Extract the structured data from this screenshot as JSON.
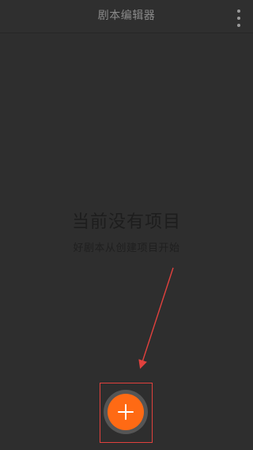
{
  "app_bar": {
    "title": "剧本编辑器",
    "menu_icon": "more-vertical-icon"
  },
  "empty_state": {
    "title": "当前没有项目",
    "subtitle": "好剧本从创建项目开始"
  },
  "fab": {
    "icon": "plus-icon",
    "color": "#ff6a14"
  },
  "annotation": {
    "color": "#e1413d"
  }
}
